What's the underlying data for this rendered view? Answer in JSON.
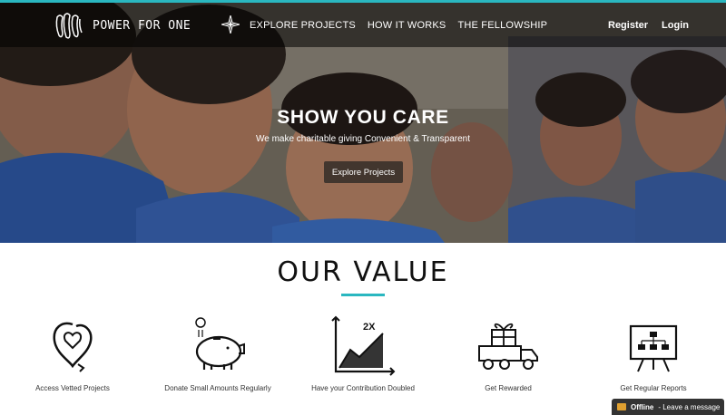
{
  "brand": {
    "name": "POWER FOR ONE",
    "accent": "#2ab7c0"
  },
  "nav": {
    "links": [
      "EXPLORE PROJECTS",
      "HOW IT WORKS",
      "THE FELLOWSHIP"
    ],
    "register": "Register",
    "login": "Login"
  },
  "hero": {
    "title": "SHOW YOU CARE",
    "subtitle": "We make charitable giving Convenient & Transparent",
    "cta": "Explore Projects"
  },
  "value": {
    "title": "OUR VALUE",
    "features": [
      {
        "label": "Access Vetted Projects",
        "icon": "heart-check-icon"
      },
      {
        "label": "Donate Small Amounts Regularly",
        "icon": "piggy-bank-icon"
      },
      {
        "label": "Have your Contribution Doubled",
        "icon": "growth-chart-icon",
        "badge": "2X"
      },
      {
        "label": "Get Rewarded",
        "icon": "gift-truck-icon"
      },
      {
        "label": "Get Regular Reports",
        "icon": "report-board-icon"
      }
    ]
  },
  "chat": {
    "status": "Offline",
    "message": "- Leave a message"
  }
}
